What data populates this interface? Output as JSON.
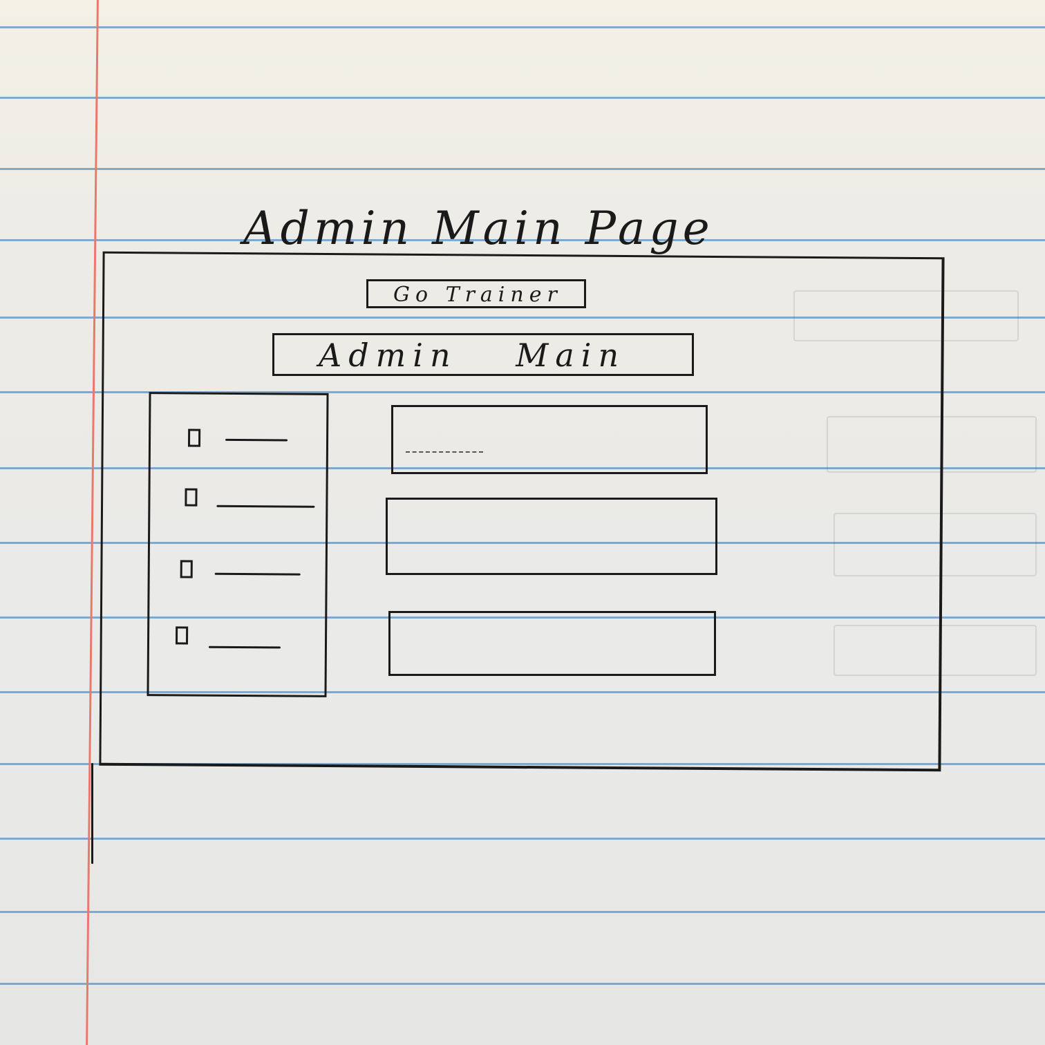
{
  "page": {
    "title": "Admin Main Page"
  },
  "buttons": {
    "go_trainer": "Go Trainer"
  },
  "banner": {
    "label": "Admin Main"
  },
  "sidebar": {
    "items": [
      {
        "checkbox": "unchecked"
      },
      {
        "checkbox": "unchecked"
      },
      {
        "checkbox": "unchecked"
      },
      {
        "checkbox": "unchecked"
      }
    ]
  },
  "content": {
    "boxes": 3
  },
  "colors": {
    "ink": "#1a1a1a",
    "rule_line": "#6e9cc6",
    "margin_line": "#e8796c",
    "paper": "#eeeeea"
  }
}
